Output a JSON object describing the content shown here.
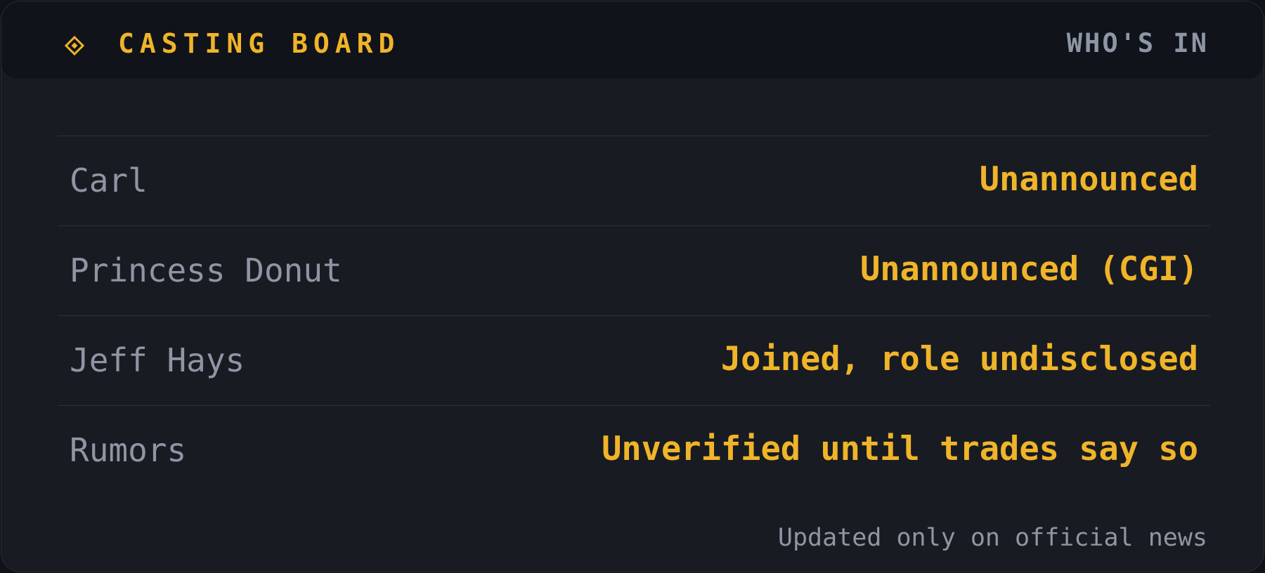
{
  "header": {
    "icon": "diamond-icon",
    "title": "CASTING BOARD",
    "right_label": "WHO'S IN"
  },
  "rows": [
    {
      "name": "Carl",
      "status": "Unannounced"
    },
    {
      "name": "Princess Donut",
      "status": "Unannounced (CGI)"
    },
    {
      "name": "Jeff Hays",
      "status": "Joined, role undisclosed"
    },
    {
      "name": "Rumors",
      "status": "Unverified until trades say so"
    }
  ],
  "footnote": "Updated only on official news",
  "colors": {
    "accent": "#f0b429",
    "muted_text": "#8f95a4",
    "card_bg": "#181b22",
    "header_bg": "#10131a",
    "divider": "#2c3039"
  }
}
